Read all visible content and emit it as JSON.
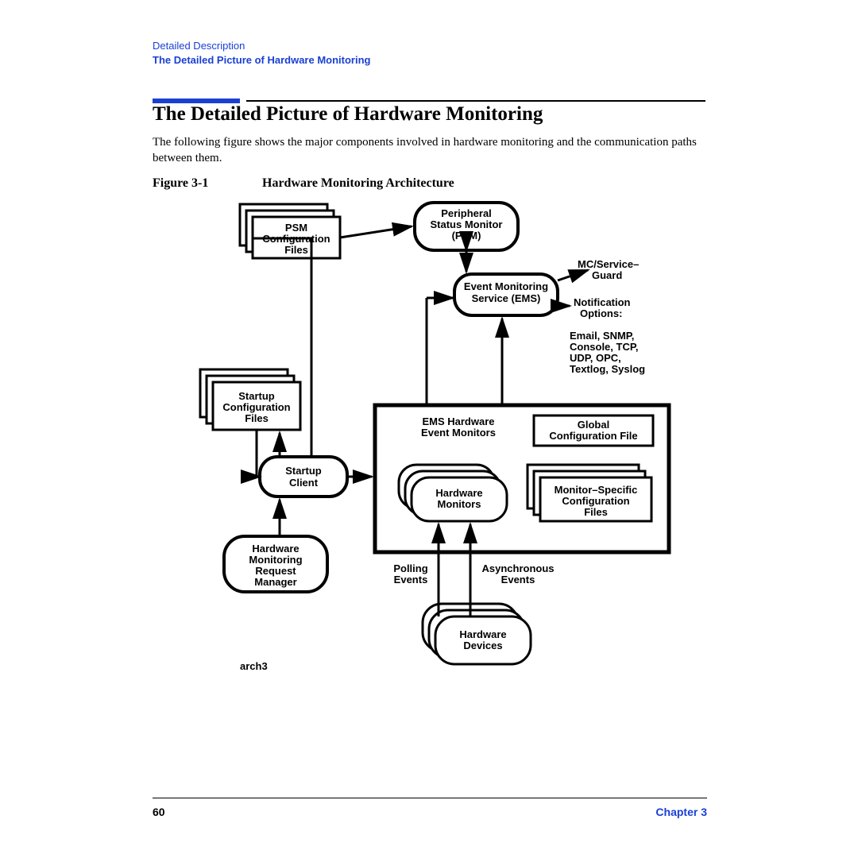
{
  "header": {
    "breadcrumb": "Detailed Description",
    "section": "The Detailed Picture of Hardware Monitoring"
  },
  "title": "The Detailed Picture of Hardware Monitoring",
  "intro": "The following figure shows the major components involved in hardware monitoring and the communication paths between them.",
  "figure": {
    "label": "Figure 3-1",
    "title": "Hardware Monitoring Architecture"
  },
  "nodes": {
    "psm_conf": "PSM Configuration Files",
    "psm": "Peripheral Status Monitor (PSM)",
    "ems": "Event Monitoring Service (EMS)",
    "guard": "MC/Service– Guard",
    "notif_title": "Notification Options:",
    "notif_body": "Email, SNMP, Console, TCP, UDP, OPC, Textlog, Syslog",
    "startup_conf": "Startup Configuration Files",
    "startup_client": "Startup Client",
    "hmrm": "Hardware Monitoring Request Manager",
    "ems_hw_title": "EMS Hardware Event Monitors",
    "hw_monitors": "Hardware Monitors",
    "global_conf": "Global Configuration File",
    "monitor_conf": "Monitor–Specific Configuration Files",
    "polling": "Polling Events",
    "async": "Asynchronous Events",
    "hw_devices": "Hardware Devices",
    "arch_label": "arch3"
  },
  "footer": {
    "page": "60",
    "chapter": "Chapter 3"
  }
}
